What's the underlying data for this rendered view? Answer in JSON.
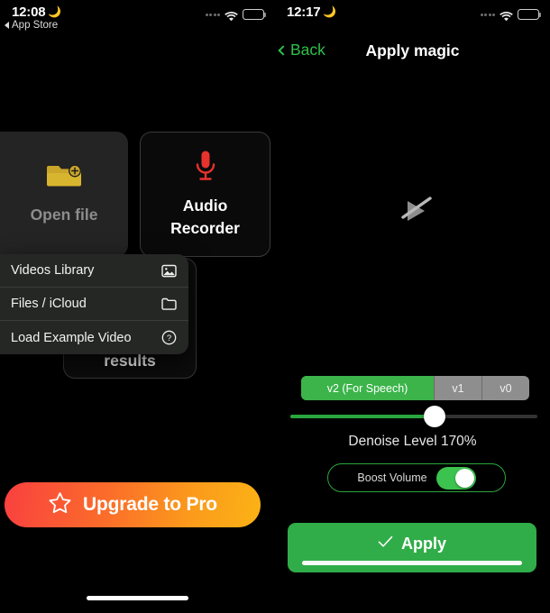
{
  "left_panel": {
    "status_bar": {
      "time": "12:08",
      "moon_icon": "crescent-moon",
      "wifi_icon": "wifi",
      "battery_icon": "battery",
      "signal_icon": "signal-dots"
    },
    "back_to_app": {
      "label": "App Store",
      "icon": "back-triangle-icon"
    },
    "cards": [
      {
        "label": "Open file",
        "icon": "folder-plus-icon",
        "state": "pressed"
      },
      {
        "label": "Audio\nRecorder",
        "line1": "Audio",
        "line2": "Recorder",
        "icon": "microphone-icon"
      }
    ],
    "results_card": {
      "label": "results"
    },
    "context_menu": {
      "items": [
        {
          "label": "Videos Library",
          "icon": "photo-icon"
        },
        {
          "label": "Files / iCloud",
          "icon": "folder-icon"
        },
        {
          "label": "Load Example Video",
          "icon": "question-circle-icon"
        }
      ]
    },
    "upgrade_button": {
      "label": "Upgrade to Pro",
      "icon": "star-icon",
      "gradient_start": "#f94040",
      "gradient_end": "#fbb315"
    }
  },
  "right_panel": {
    "status_bar": {
      "time": "12:17",
      "moon_icon": "crescent-moon",
      "wifi_icon": "wifi",
      "battery_icon": "battery",
      "signal_icon": "signal-dots"
    },
    "nav": {
      "settings_icon": "gear-icon",
      "back_label": "Back",
      "back_icon": "chevron-left-icon",
      "title": "Apply magic",
      "accent": "#2fbf4a"
    },
    "video": {
      "placeholder_icon": "play-slash-icon"
    },
    "segmented_control": {
      "options": [
        "v2 (For Speech)",
        "v1",
        "v0"
      ],
      "selected_index": 0,
      "selected_color": "#3cb44a"
    },
    "slider": {
      "percent": 56,
      "fill_color": "#29a63f"
    },
    "denoise_label": "Denoise Level 170%",
    "boost_volume": {
      "label": "Boost Volume",
      "enabled": true,
      "border_color": "#2aa63c"
    },
    "apply_button": {
      "label": "Apply",
      "icon": "check-icon",
      "color": "#30ad48",
      "progress": 100
    }
  }
}
